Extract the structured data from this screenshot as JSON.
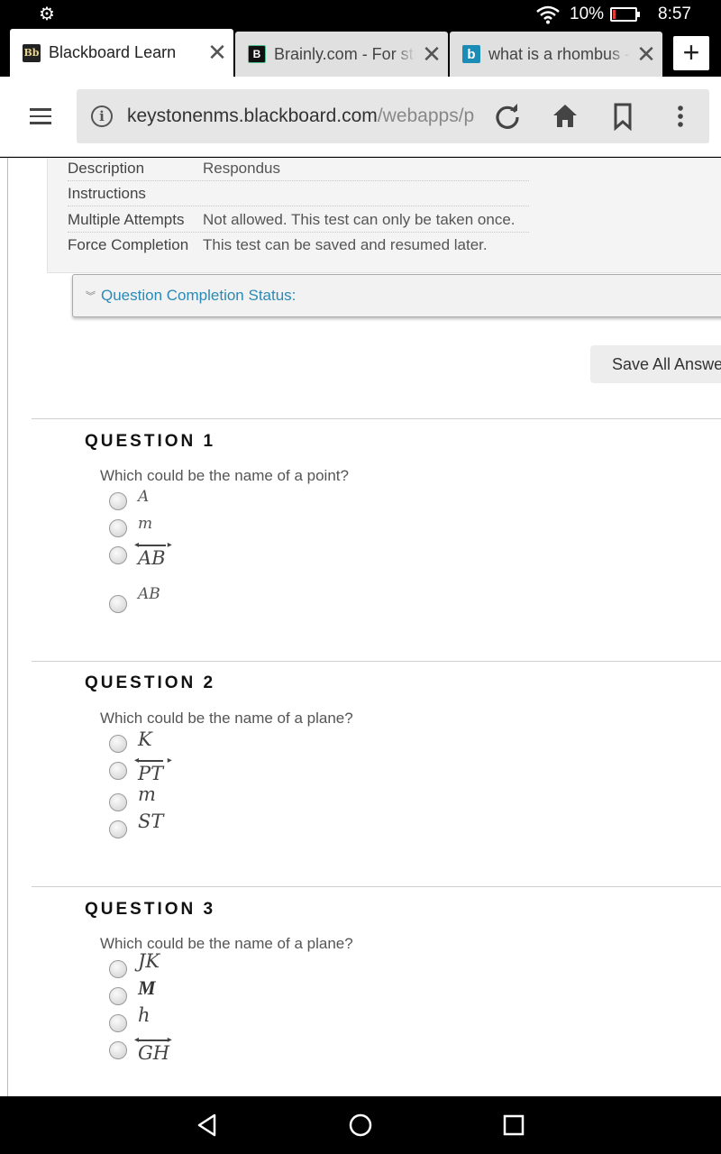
{
  "status": {
    "battery": "10%",
    "time": "8:57"
  },
  "tabs": [
    {
      "label": "Blackboard Learn",
      "favicon": "Bb",
      "active": true
    },
    {
      "label": "Brainly.com - For stu",
      "favicon": "B",
      "active": false
    },
    {
      "label": "what is a rhombus -",
      "favicon": "b",
      "active": false
    }
  ],
  "toolbar": {
    "url_host": "keystonenms.blackboard.com",
    "url_path": "/webapps/p"
  },
  "test_info": {
    "rows": [
      {
        "key": "Description",
        "value": "Respondus"
      },
      {
        "key": "Instructions",
        "value": ""
      },
      {
        "key": "Multiple Attempts",
        "value": "Not allowed. This test can only be taken once."
      },
      {
        "key": "Force Completion",
        "value": "This test can be saved and resumed later."
      }
    ]
  },
  "completion_status": {
    "label": "Question Completion Status:"
  },
  "save_all": {
    "label": "Save All Answers"
  },
  "questions": [
    {
      "title": "QUESTION 1",
      "text": "Which could be the name of a point?",
      "options": [
        "A",
        "m",
        "AB",
        "AB"
      ]
    },
    {
      "title": "QUESTION 2",
      "text": "Which could be the name of a plane?",
      "options": [
        "K",
        "PT",
        "m",
        "ST"
      ]
    },
    {
      "title": "QUESTION 3",
      "text": "Which could be the name of a plane?",
      "options": [
        "JK",
        "M",
        "h",
        "GH"
      ]
    }
  ]
}
